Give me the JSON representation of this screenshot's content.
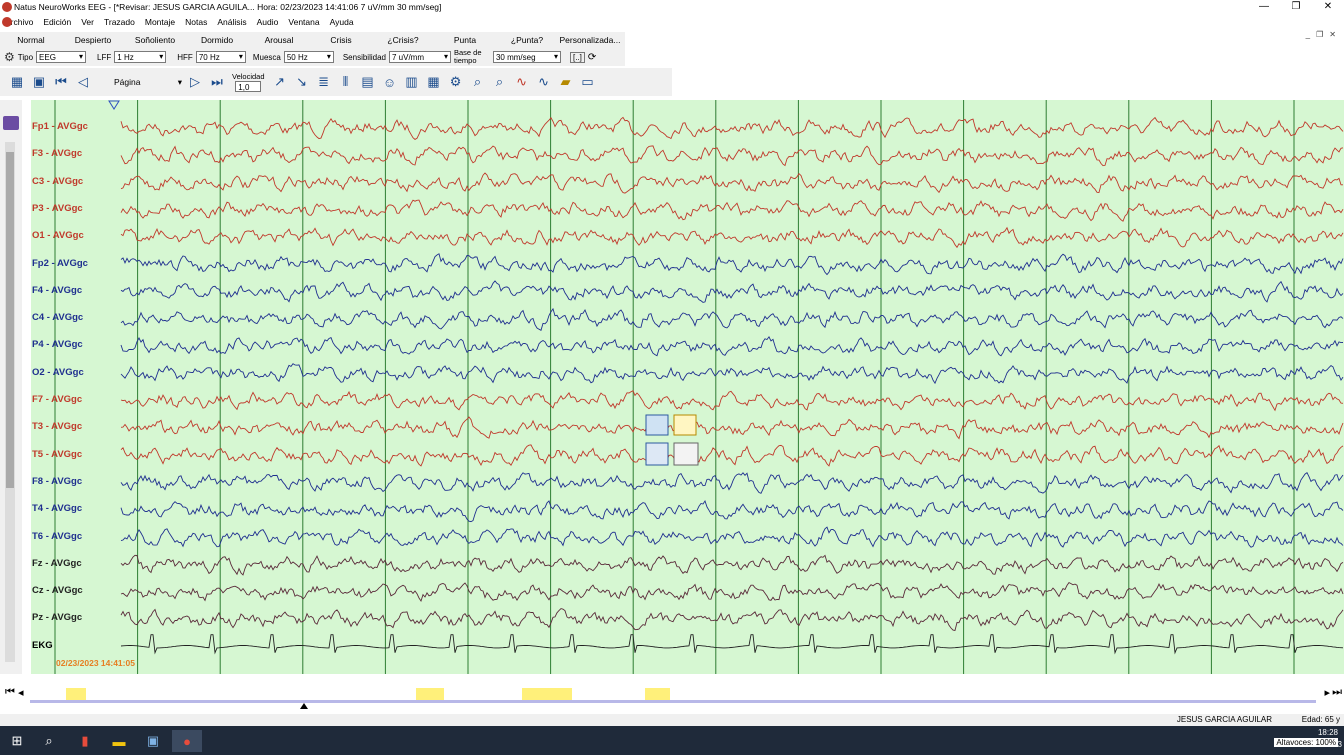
{
  "window": {
    "title": "Natus NeuroWorks EEG - [*Revisar:  JESUS  GARCIA AGUILA...   Hora: 02/23/2023 14:41:06   7 uV/mm   30 mm/seg]",
    "minimize": "—",
    "restore": "❐",
    "close": "✕"
  },
  "menu": [
    "Archivo",
    "Edición",
    "Ver",
    "Trazado",
    "Montaje",
    "Notas",
    "Análisis",
    "Audio",
    "Ventana",
    "Ayuda"
  ],
  "protocols": [
    "Normal",
    "Despierto",
    "Soñoliento",
    "Dormido",
    "Arousal",
    "Crisis",
    "¿Crisis?",
    "Punta",
    "¿Punta?",
    "Personalizada..."
  ],
  "filters": {
    "tipo_label": "Tipo",
    "tipo_value": "EEG",
    "lff_label": "LFF",
    "lff_value": "1 Hz",
    "hff_label": "HFF",
    "hff_value": "70 Hz",
    "muesca_label": "Muesca",
    "muesca_value": "50 Hz",
    "sens_label": "Sensibilidad",
    "sens_value": "7 uV/mm",
    "base_label": "Base de tiempo",
    "base_value": "30 mm/seg"
  },
  "toolbar": {
    "pagina": "Página",
    "velocidad_label": "Velocidad",
    "velocidad_value": "1,0"
  },
  "channels": [
    {
      "label": "Fp1 - AVGgc",
      "color": "#c0392b"
    },
    {
      "label": "F3 - AVGgc",
      "color": "#c0392b"
    },
    {
      "label": "C3 - AVGgc",
      "color": "#c0392b"
    },
    {
      "label": "P3 - AVGgc",
      "color": "#c0392b"
    },
    {
      "label": "O1 - AVGgc",
      "color": "#c0392b"
    },
    {
      "label": "Fp2 - AVGgc",
      "color": "#1f2f8f"
    },
    {
      "label": "F4 - AVGgc",
      "color": "#1f2f8f"
    },
    {
      "label": "C4 - AVGgc",
      "color": "#1f2f8f"
    },
    {
      "label": "P4 - AVGgc",
      "color": "#1f2f8f"
    },
    {
      "label": "O2 - AVGgc",
      "color": "#1f2f8f"
    },
    {
      "label": "F7 - AVGgc",
      "color": "#c0392b"
    },
    {
      "label": "T3 - AVGgc",
      "color": "#c0392b"
    },
    {
      "label": "T5 - AVGgc",
      "color": "#c0392b"
    },
    {
      "label": "F8 - AVGgc",
      "color": "#1f2f8f"
    },
    {
      "label": "T4 - AVGgc",
      "color": "#1f2f8f"
    },
    {
      "label": "T6 - AVGgc",
      "color": "#1f2f8f"
    },
    {
      "label": "Fz - AVGgc",
      "color": "#5a2a3a"
    },
    {
      "label": "Cz - AVGgc",
      "color": "#5a2a3a"
    },
    {
      "label": "Pz - AVGgc",
      "color": "#5a2a3a"
    },
    {
      "label": "EKG",
      "color": "#222222"
    }
  ],
  "timestamp": "02/23/2023 14:41:05",
  "status": {
    "patient": "JESUS  GARCIA AGUILAR",
    "age": "Edad: 65 y"
  },
  "taskbar": {
    "time": "18:28",
    "volume": "Altavoces: 100%",
    "notifications": "3"
  },
  "colors": {
    "eeg_background": "#d6f7d2",
    "second_line": "#2e7d32"
  }
}
